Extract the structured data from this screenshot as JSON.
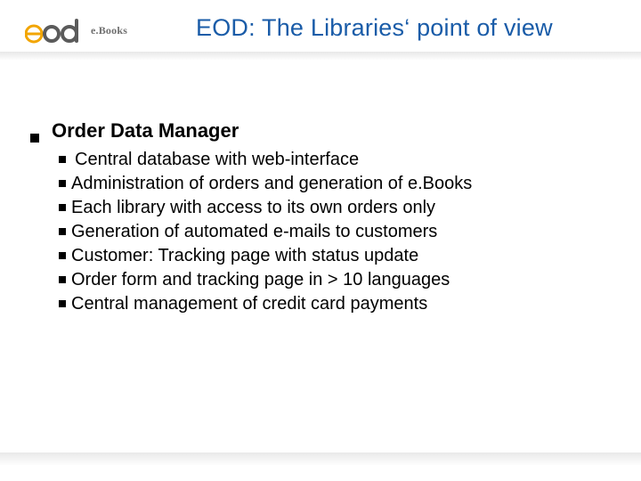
{
  "logo": {
    "ebooks_label": "e.Books"
  },
  "title": "EOD: The Libraries‘ point of view",
  "heading": "Order Data Manager",
  "items": [
    " Central database with web-interface",
    "Administration of orders and generation of e.Books",
    "Each library with access to its own orders only",
    "Generation of automated e-mails to customers",
    "Customer: Tracking page with status update",
    "Order form and tracking page in > 10 languages",
    "Central management of credit card payments"
  ]
}
